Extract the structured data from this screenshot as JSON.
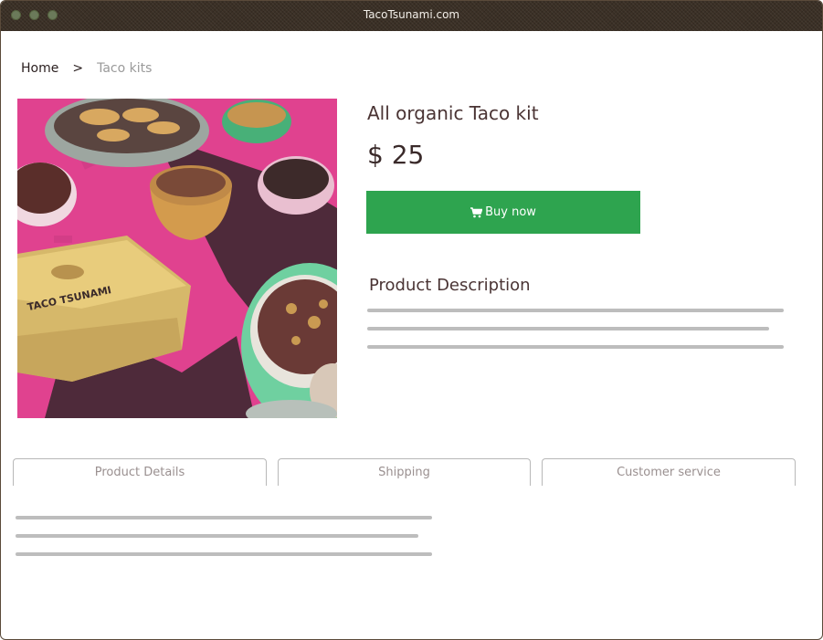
{
  "window": {
    "title": "TacoTsunami.com"
  },
  "breadcrumb": {
    "home": "Home",
    "separator": ">",
    "current": "Taco kits"
  },
  "product": {
    "title": "All organic Taco kit",
    "price": "$ 25",
    "buy_label": "Buy now",
    "image_brand_text": "TACO TSUNAMI"
  },
  "description": {
    "heading": "Product Description"
  },
  "tabs": [
    {
      "label": "Product Details"
    },
    {
      "label": "Shipping"
    },
    {
      "label": "Customer service"
    }
  ],
  "colors": {
    "accent_green": "#2ea44f",
    "placeholder_line": "#bdbdbd",
    "image_pink": "#e0428f"
  },
  "icons": {
    "buy": "cart-icon"
  }
}
